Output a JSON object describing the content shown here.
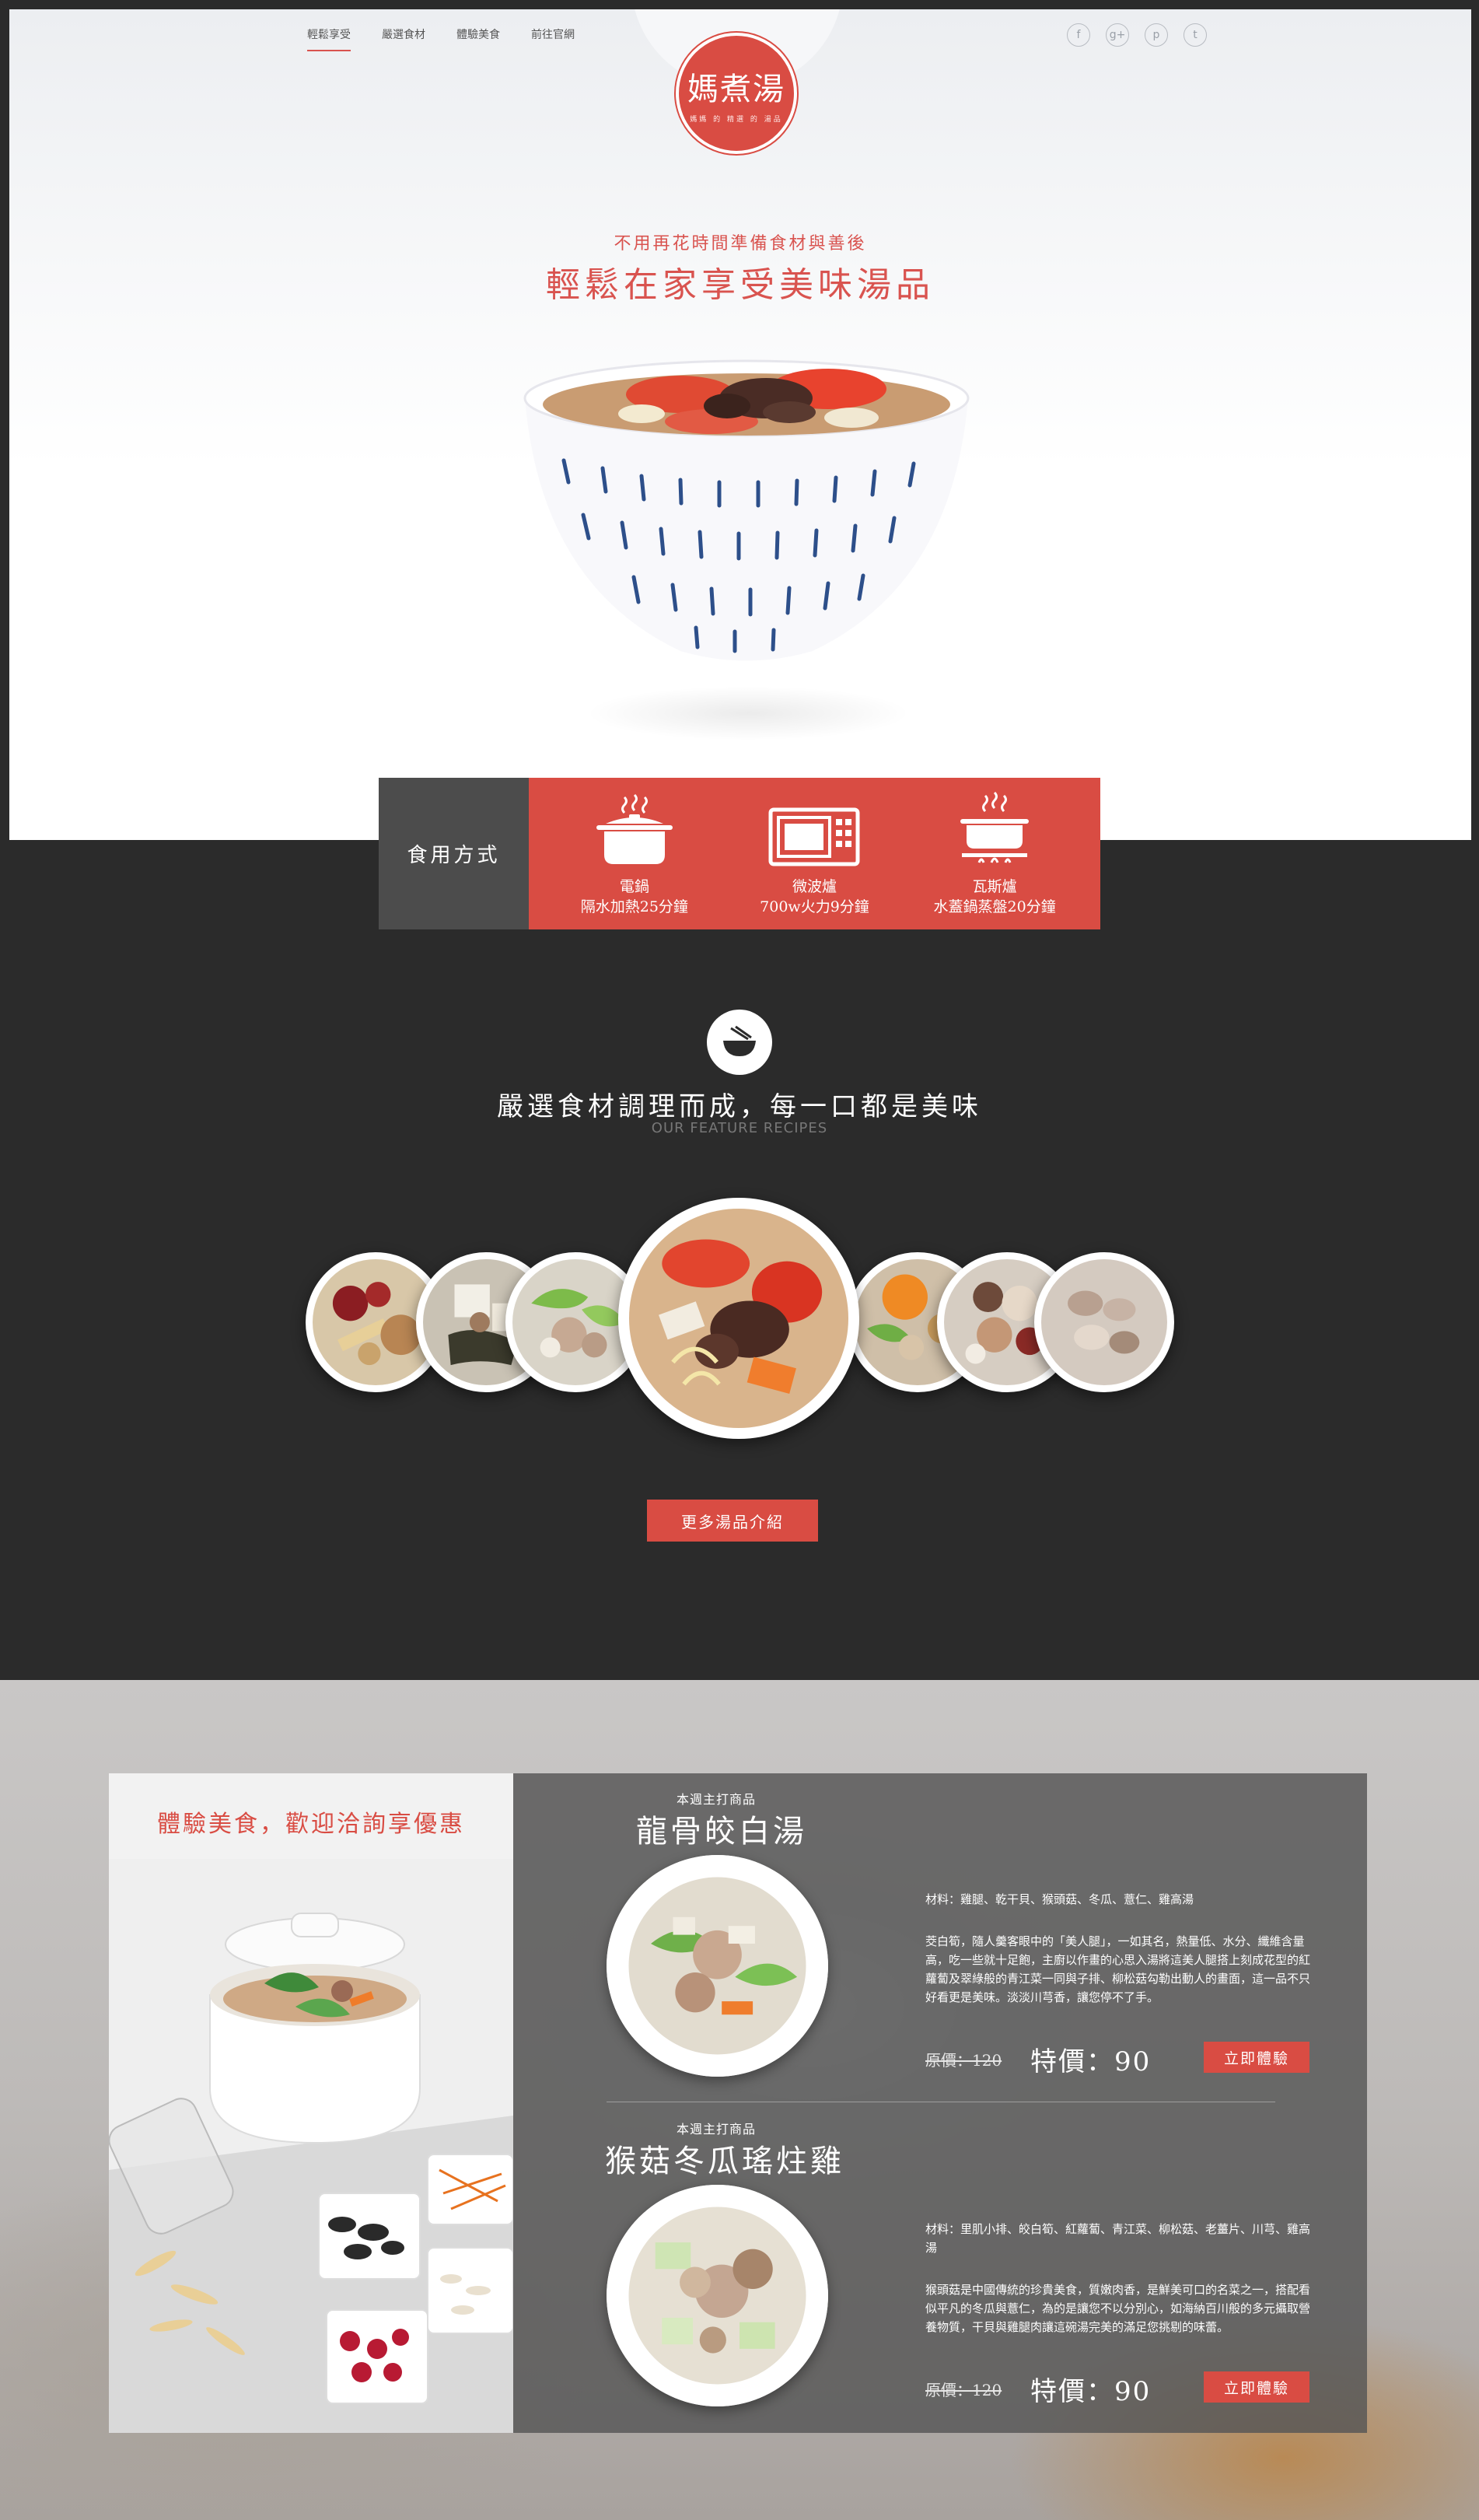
{
  "nav": {
    "items": [
      "輕鬆享受",
      "嚴選食材",
      "體驗美食",
      "前往官網"
    ],
    "active_index": 0
  },
  "social": [
    "f",
    "g+",
    "p",
    "t"
  ],
  "logo": {
    "title": "媽煮湯",
    "subtitle": "媽媽  的  精選  的  湯品"
  },
  "hero": {
    "subtitle": "不用再花時間準備食材與善後",
    "title": "輕鬆在家享受美味湯品"
  },
  "usage": {
    "label": "食用方式",
    "methods": [
      {
        "icon": "rice-cooker-icon",
        "name": "電鍋",
        "desc": "隔水加熱25分鐘"
      },
      {
        "icon": "microwave-icon",
        "name": "微波爐",
        "desc": "700w火力9分鐘"
      },
      {
        "icon": "gas-stove-pot-icon",
        "name": "瓦斯爐",
        "desc": "水蓋鍋蒸盤20分鐘"
      }
    ]
  },
  "features": {
    "icon": "rice-bowl-chopsticks-icon",
    "title": "嚴選食材調理而成，每一口都是美味",
    "subtitle": "OUR FEATURE RECIPES",
    "more_button": "更多湯品介紹"
  },
  "promo": {
    "left_title": "體驗美食，歡迎洽詢享優惠",
    "products": [
      {
        "week_label": "本週主打商品",
        "name": "龍骨皎白湯",
        "materials": "材料：雞腿、乾干貝、猴頭菇、冬瓜、薏仁、雞高湯",
        "description": "茭白筍，隨人羹客眼中的「美人腿」，一如其名，熱量低、水分、纖維含量高，吃一些就十足飽，主廚以作畫的心思入湯將這美人腿搭上刻成花型的紅蘿蔔及翠綠般的青江菜一同與子排、柳松菇勾勒出動人的畫面，這一品不只好看更是美味。淡淡川芎香，讓您停不了手。",
        "original_price": "原價：120",
        "special_price": "特價：90",
        "button": "立即體驗"
      },
      {
        "week_label": "本週主打商品",
        "name": "猴菇冬瓜瑤炷雞",
        "materials": "材料：里肌小排、皎白筍、紅蘿蔔、青江菜、柳松菇、老薑片、川芎、雞高湯",
        "description": "猴頭菇是中國傳統的珍貴美食，質嫩肉香，是鮮美可口的名菜之一，搭配看似平凡的冬瓜與薏仁，為的是讓您不以分別心，如海納百川般的多元攝取營養物質，干貝與雞腿肉讓這碗湯完美的滿足您挑剔的味蕾。",
        "original_price": "原價：120",
        "special_price": "特價：90",
        "button": "立即體驗"
      }
    ]
  },
  "colors": {
    "accent": "#d94c43",
    "dark_bg": "#2b2b2b",
    "usage_label_bg": "#4c4c4c"
  }
}
